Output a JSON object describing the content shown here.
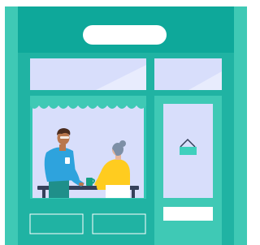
{
  "colors": {
    "facade_light": "#3fc9b5",
    "facade_main": "#20b3a3",
    "sign_board": "#0ea89a",
    "sign_plate": "#ffffff",
    "window_glass": "#d8defb",
    "window_frame": "#34c7b4",
    "man_shirt": "#2ea3dd",
    "man_pants": "#1f8f8a",
    "woman_shirt": "#ffcc1f",
    "woman_hair": "#7d8fa6",
    "table": "#35405a",
    "door_sign": "#3fd0bd",
    "cup": "#16a085"
  },
  "icons": {
    "door_sign": "hanging-sign-icon",
    "awning": "scalloped-awning-icon"
  }
}
